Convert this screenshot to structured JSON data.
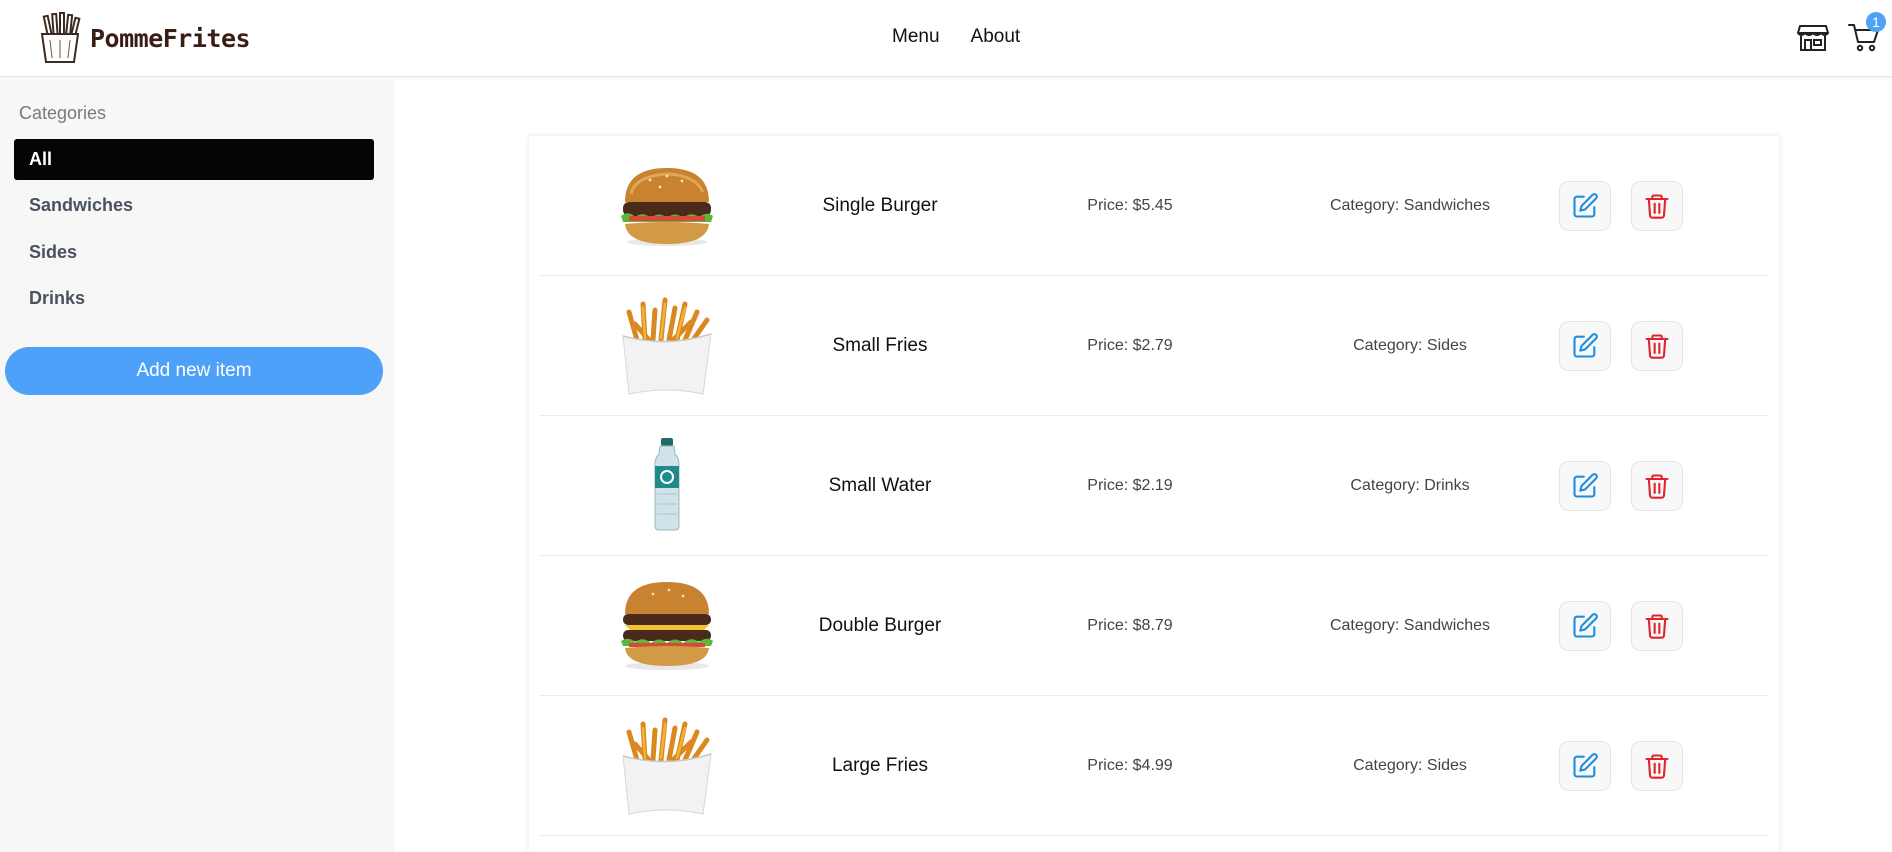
{
  "brand": {
    "name": "PommeFrites",
    "logo_icon": "fries-bag-logo"
  },
  "nav": {
    "menu": "Menu",
    "about": "About"
  },
  "header": {
    "store_icon": "store-icon",
    "cart_icon": "cart-icon",
    "cart_count": "1"
  },
  "sidebar": {
    "heading": "Categories",
    "items": [
      {
        "label": "All",
        "active": true
      },
      {
        "label": "Sandwiches",
        "active": false
      },
      {
        "label": "Sides",
        "active": false
      },
      {
        "label": "Drinks",
        "active": false
      }
    ],
    "add_button": "Add new item"
  },
  "items": [
    {
      "name": "Single Burger",
      "price": "Price: $5.45",
      "category": "Category: Sandwiches",
      "image": "single-burger-image"
    },
    {
      "name": "Small Fries",
      "price": "Price: $2.79",
      "category": "Category: Sides",
      "image": "small-fries-image"
    },
    {
      "name": "Small Water",
      "price": "Price: $2.19",
      "category": "Category: Drinks",
      "image": "small-water-image"
    },
    {
      "name": "Double Burger",
      "price": "Price: $8.79",
      "category": "Category: Sandwiches",
      "image": "double-burger-image"
    },
    {
      "name": "Large Fries",
      "price": "Price: $4.99",
      "category": "Category: Sides",
      "image": "large-fries-image"
    }
  ],
  "colors": {
    "accent": "#4ea1f8",
    "edit": "#1a8fe0",
    "delete": "#e0242c",
    "active_category": "#050505"
  }
}
